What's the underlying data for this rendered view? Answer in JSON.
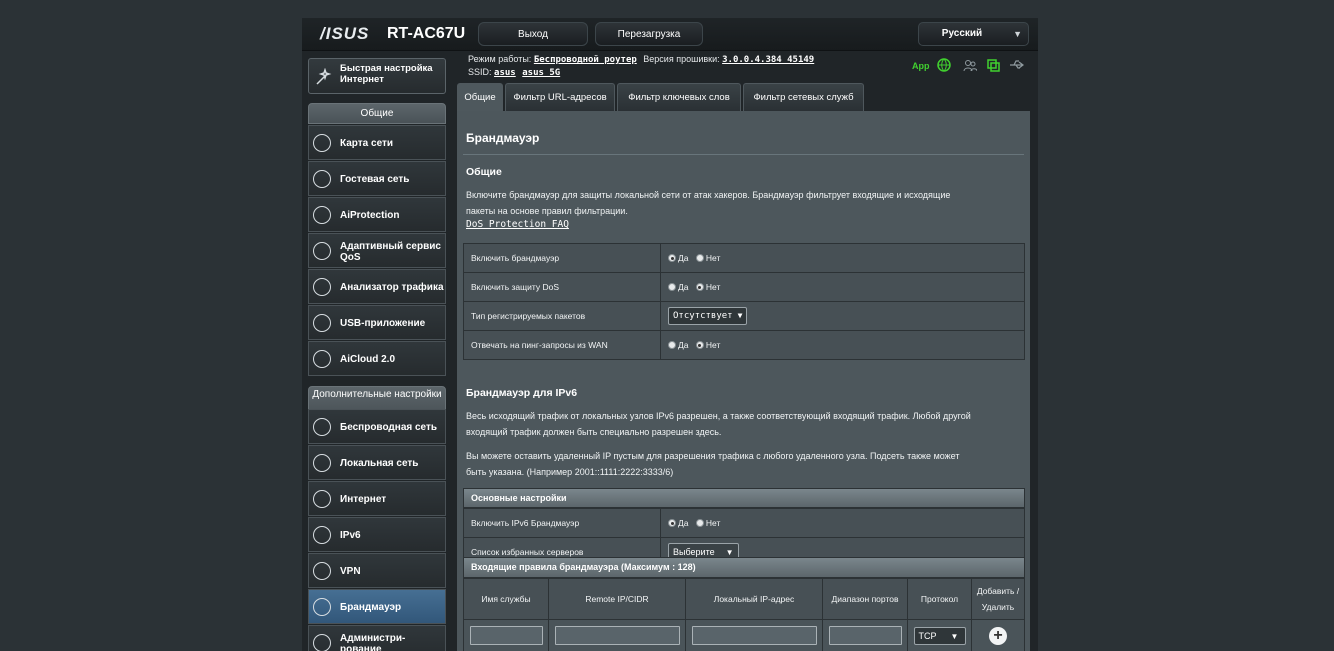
{
  "header": {
    "logo": "/ISUS",
    "model": "RT-AC67U",
    "logout_label": "Выход",
    "reboot_label": "Перезагрузка",
    "language": "Русский"
  },
  "status": {
    "mode_label": "Режим работы:",
    "mode_value": "Беспроводной роутер",
    "fw_label": "Версия прошивки:",
    "fw_value": "3.0.0.4.384_45149",
    "ssid_label": "SSID:",
    "ssid_1": "asus",
    "ssid_2": "asus_5G",
    "app_label": "App"
  },
  "sidebar": {
    "quick": "Быстрая настройка Интернет",
    "general_title": "Общие",
    "general_items": [
      {
        "label": "Карта сети",
        "icon": "globe-icon"
      },
      {
        "label": "Гостевая сеть",
        "icon": "guest-network-icon"
      },
      {
        "label": "AiProtection",
        "icon": "shield-icon"
      },
      {
        "label": "Адаптивный сервис QoS",
        "icon": "speedometer-icon"
      },
      {
        "label": "Анализатор трафика",
        "icon": "traffic-analyzer-icon"
      },
      {
        "label": "USB-приложение",
        "icon": "usb-icon"
      },
      {
        "label": "AiCloud 2.0",
        "icon": "cloud-icon"
      }
    ],
    "advanced_title": "Дополнительные настройки",
    "advanced_items": [
      {
        "label": "Беспроводная сеть",
        "icon": "wireless-icon"
      },
      {
        "label": "Локальная сеть",
        "icon": "lan-icon"
      },
      {
        "label": "Интернет",
        "icon": "internet-icon"
      },
      {
        "label": "IPv6",
        "icon": "ipv6-icon"
      },
      {
        "label": "VPN",
        "icon": "vpn-icon"
      },
      {
        "label": "Брандмауэр",
        "icon": "firewall-icon"
      },
      {
        "label": "Администри-\nрование",
        "icon": "gear-icon"
      }
    ]
  },
  "tabs": [
    "Общие",
    "Фильтр URL-адресов",
    "Фильтр ключевых слов",
    "Фильтр сетевых служб"
  ],
  "page": {
    "title": "Брандмауэр",
    "general_heading": "Общие",
    "general_text_1": "Включите брандмауэр для защиты локальной сети от атак хакеров. Брандмауэр фильтрует входящие и исходящие",
    "general_text_2": "пакеты на основе правил фильтрации.",
    "faq_link": "DoS Protection FAQ",
    "settings": [
      {
        "label": "Включить брандмауэр",
        "yes": "Да",
        "no": "Нет",
        "value": "yes"
      },
      {
        "label": "Включить защиту DoS",
        "yes": "Да",
        "no": "Нет",
        "value": "no"
      },
      {
        "label": "Тип регистрируемых пакетов",
        "select": "Отсутствует"
      },
      {
        "label": "Отвечать на пинг-запросы из WAN",
        "yes": "Да",
        "no": "Нет",
        "value": "no"
      }
    ],
    "ipv6_heading": "Брандмауэр для IPv6",
    "ipv6_text_1": "Весь исходящий трафик от локальных узлов IPv6 разрешен, а также соответствующий входящий трафик. Любой другой",
    "ipv6_text_2": "входящий трафик должен быть специально разрешен здесь.",
    "ipv6_text_3": "Вы можете оставить удаленный IP пустым для разрешения трафика с любого удаленного узла. Подсеть также может",
    "ipv6_text_4": "быть указана. (Например 2001::1111:2222:3333/6)",
    "basic_header": "Основные настройки",
    "ipv6_settings": [
      {
        "label": "Включить IPv6 Брандмауэр",
        "yes": "Да",
        "no": "Нет",
        "value": "yes"
      },
      {
        "label": "Список избранных серверов",
        "select": "Выберите"
      }
    ],
    "rules_header": "Входящие правила брандмауэра (Максимум : 128)",
    "rules_columns": [
      "Имя службы",
      "Remote IP/CIDR",
      "Локальный IP-адрес",
      "Диапазон портов",
      "Протокол",
      "Добавить / Удалить"
    ],
    "protocol_value": "TCP"
  }
}
